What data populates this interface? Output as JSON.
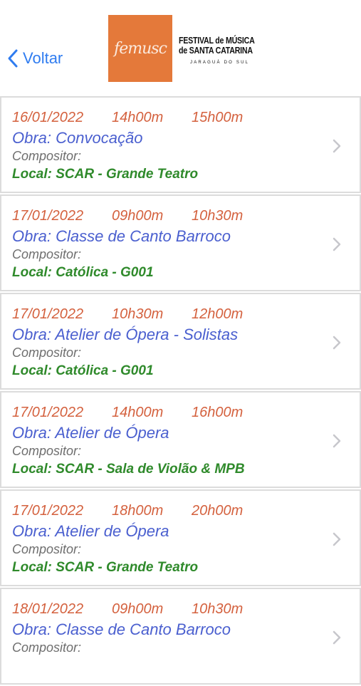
{
  "header": {
    "back_label": "Voltar",
    "logo_text": "femusc",
    "festival_line1": "FESTIVAL de MÚSICA",
    "festival_line2": "de SANTA CATARINA",
    "festival_city": "JARAGUÁ DO SUL"
  },
  "colors": {
    "date": "#d4613e",
    "obra": "#4a5fcf",
    "composer": "#6e6e6e",
    "local": "#2f8a2b",
    "accent": "#2f7cf0",
    "logo_bg": "#e4793a"
  },
  "events": [
    {
      "date": "16/01/2022",
      "start": "14h00m",
      "end": "15h00m",
      "obra": "Obra: Convocação",
      "compositor": "Compositor:",
      "local": "Local: SCAR - Grande Teatro"
    },
    {
      "date": "17/01/2022",
      "start": "09h00m",
      "end": "10h30m",
      "obra": "Obra: Classe de Canto Barroco",
      "compositor": "Compositor:",
      "local": "Local: Católica - G001"
    },
    {
      "date": "17/01/2022",
      "start": "10h30m",
      "end": "12h00m",
      "obra": "Obra: Atelier de Ópera - Solistas",
      "compositor": "Compositor:",
      "local": "Local: Católica - G001"
    },
    {
      "date": "17/01/2022",
      "start": "14h00m",
      "end": "16h00m",
      "obra": "Obra: Atelier de Ópera",
      "compositor": "Compositor:",
      "local": "Local: SCAR - Sala de Violão & MPB"
    },
    {
      "date": "17/01/2022",
      "start": "18h00m",
      "end": "20h00m",
      "obra": "Obra: Atelier de Ópera",
      "compositor": "Compositor:",
      "local": "Local: SCAR - Grande Teatro"
    },
    {
      "date": "18/01/2022",
      "start": "09h00m",
      "end": "10h30m",
      "obra": "Obra: Classe de Canto Barroco",
      "compositor": "Compositor:",
      "local": ""
    }
  ]
}
